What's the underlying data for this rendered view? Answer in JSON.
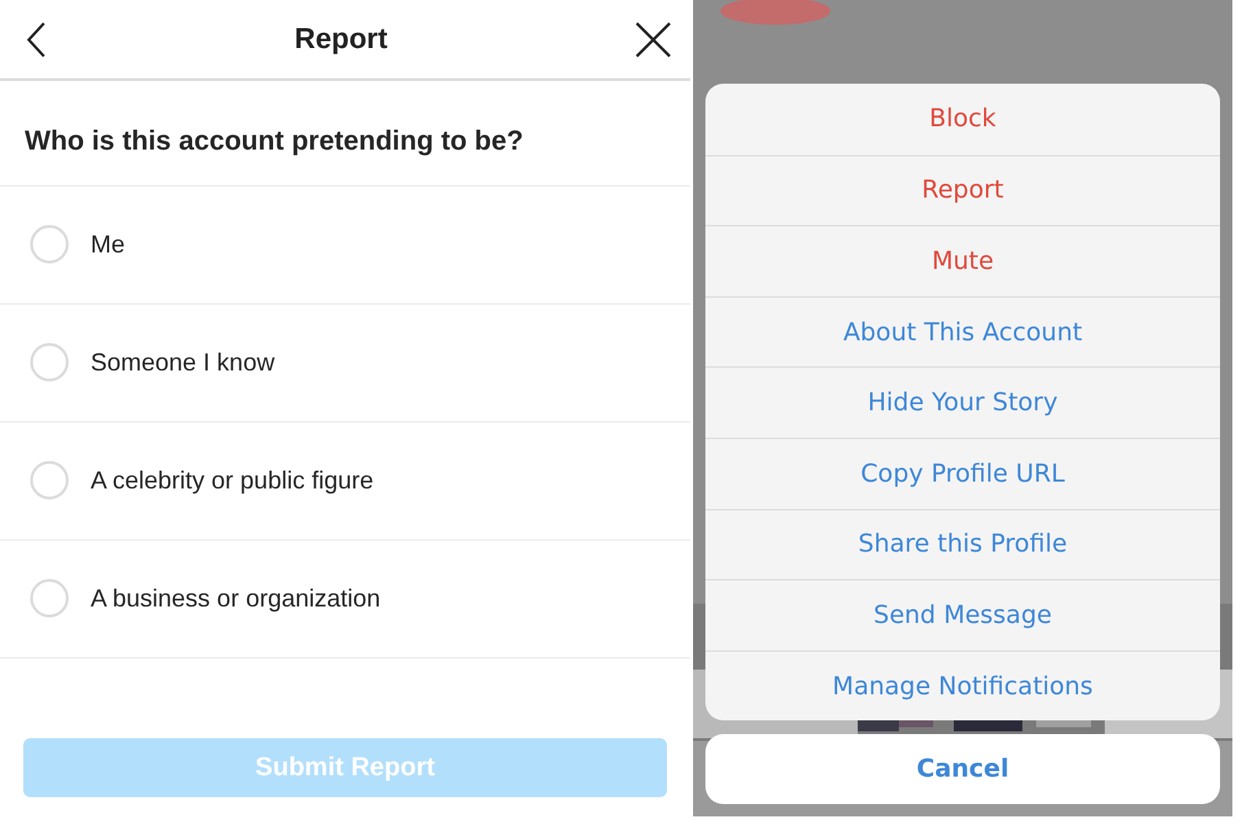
{
  "report": {
    "title": "Report",
    "question": "Who is this account pretending to be?",
    "options": [
      {
        "label": "Me",
        "selected": false
      },
      {
        "label": "Someone I know",
        "selected": false
      },
      {
        "label": "A celebrity or public figure",
        "selected": false
      },
      {
        "label": "A business or organization",
        "selected": false
      }
    ],
    "submit": {
      "label": "Submit Report",
      "disabled": true
    }
  },
  "action_sheet": {
    "actions": [
      {
        "label": "Block",
        "kind": "destructive"
      },
      {
        "label": "Report",
        "kind": "destructive"
      },
      {
        "label": "Mute",
        "kind": "destructive"
      },
      {
        "label": "About This Account",
        "kind": "default"
      },
      {
        "label": "Hide Your Story",
        "kind": "default"
      },
      {
        "label": "Copy Profile URL",
        "kind": "default"
      },
      {
        "label": "Share this Profile",
        "kind": "default"
      },
      {
        "label": "Send Message",
        "kind": "default"
      },
      {
        "label": "Manage Notifications",
        "kind": "default"
      }
    ],
    "cancel": "Cancel"
  }
}
